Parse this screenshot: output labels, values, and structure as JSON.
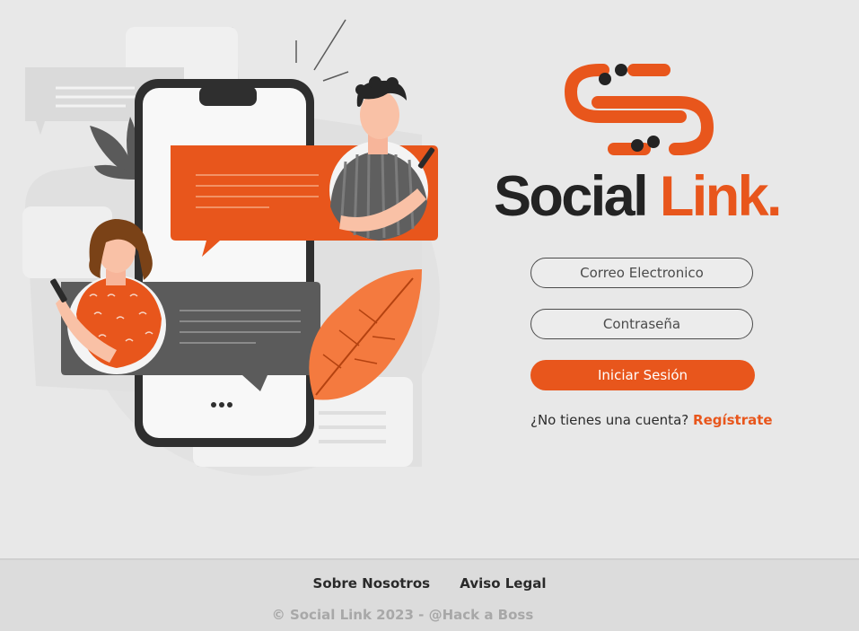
{
  "brand": {
    "name_main": "Social",
    "name_accent": "Link.",
    "accent_color": "#e8561c",
    "dark_color": "#232323"
  },
  "illustration": {
    "name": "chat-phone-illustration",
    "typing_indicator": "•••"
  },
  "login_form": {
    "email_placeholder": "Correo Electronico",
    "password_placeholder": "Contraseña",
    "submit_label": "Iniciar Sesión",
    "signup_prompt": "¿No tienes una cuenta?",
    "signup_link": "Regístrate"
  },
  "footer": {
    "links": [
      "Sobre Nosotros",
      "Aviso Legal"
    ],
    "copyright": "© Social Link 2023 - @Hack a Boss"
  }
}
